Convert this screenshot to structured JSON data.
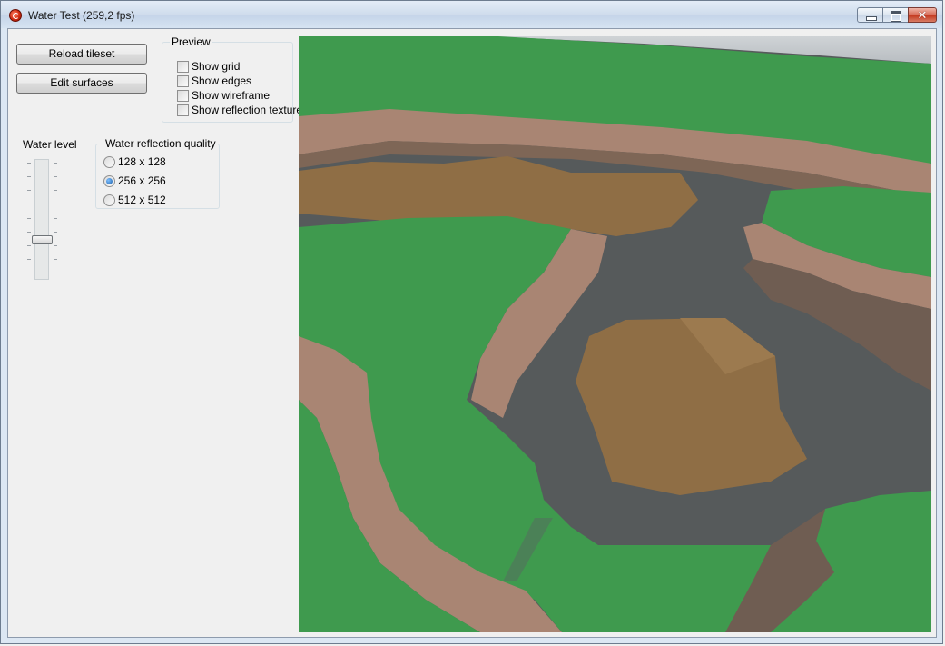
{
  "window": {
    "title": "Water Test (259,2 fps)",
    "icon": "app-icon"
  },
  "caption_buttons": {
    "close_glyph": "✕"
  },
  "buttons": {
    "reload_tileset": "Reload tileset",
    "edit_surfaces": "Edit surfaces"
  },
  "preview": {
    "group_label": "Preview",
    "options": [
      {
        "label": "Show grid",
        "checked": false
      },
      {
        "label": "Show edges",
        "checked": false
      },
      {
        "label": "Show wireframe",
        "checked": false
      },
      {
        "label": "Show reflection texture",
        "checked": false
      }
    ]
  },
  "water_level": {
    "label": "Water level",
    "level_fraction": 0.28
  },
  "reflection_quality": {
    "group_label": "Water reflection quality",
    "options": [
      {
        "label": "128 x 128",
        "checked": false
      },
      {
        "label": "256 x 256",
        "checked": true
      },
      {
        "label": "512 x 512",
        "checked": false
      }
    ]
  },
  "viewport": {
    "description_icon": "3d-terrain-view",
    "colors": {
      "grass": "#3f9a4e",
      "cliff": "#a98573",
      "sand": "#8f6e45",
      "water": "#5b5e5f"
    }
  }
}
